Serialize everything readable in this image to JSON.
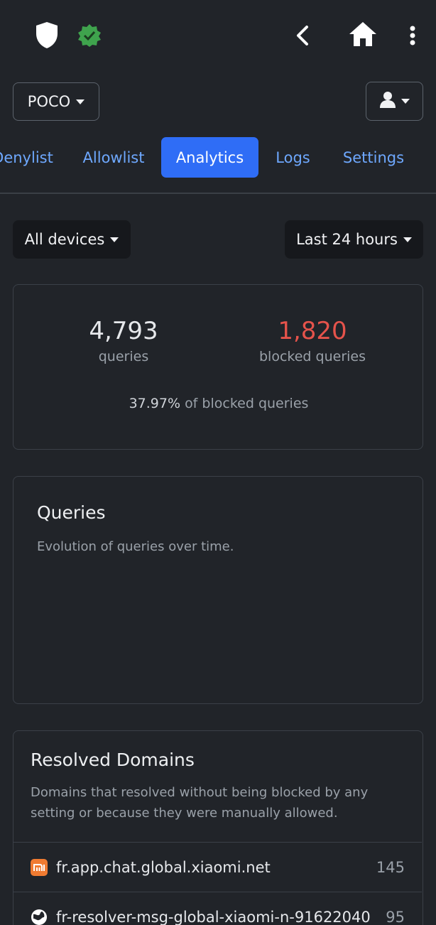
{
  "appbar": {
    "icons": [
      "shield-icon",
      "verified-badge-icon",
      "back-icon",
      "home-icon",
      "more-vert-icon"
    ],
    "verified_color": "#3fa34d"
  },
  "profile": {
    "label": "POCO"
  },
  "tabs": [
    {
      "label": "Denylist",
      "active": false
    },
    {
      "label": "Allowlist",
      "active": false
    },
    {
      "label": "Analytics",
      "active": true
    },
    {
      "label": "Logs",
      "active": false
    },
    {
      "label": "Settings",
      "active": false
    }
  ],
  "filters": {
    "devices": "All devices",
    "period": "Last 24 hours"
  },
  "stats": {
    "total": "4,793",
    "total_label": "queries",
    "blocked": "1,820",
    "blocked_label": "blocked queries",
    "blocked_color": "#e5534b",
    "ratio": "37.97%",
    "ratio_suffix": "of blocked queries"
  },
  "queries_card": {
    "title": "Queries",
    "subtitle": "Evolution of queries over time."
  },
  "domains_card": {
    "title": "Resolved Domains",
    "subtitle": "Domains that resolved without being blocked by any setting or because they were manually allowed.",
    "rows": [
      {
        "name": "fr.app.chat.global.xiaomi.net",
        "count": "145",
        "icon": "xiaomi-logo-icon"
      },
      {
        "name": "fr-resolver-msg-global-xiaomi-n-91622040",
        "count": "95",
        "icon": "globe-icon"
      }
    ]
  },
  "colors": {
    "background": "#212429",
    "accent": "#2f6df6",
    "link": "#6ea8fe"
  }
}
